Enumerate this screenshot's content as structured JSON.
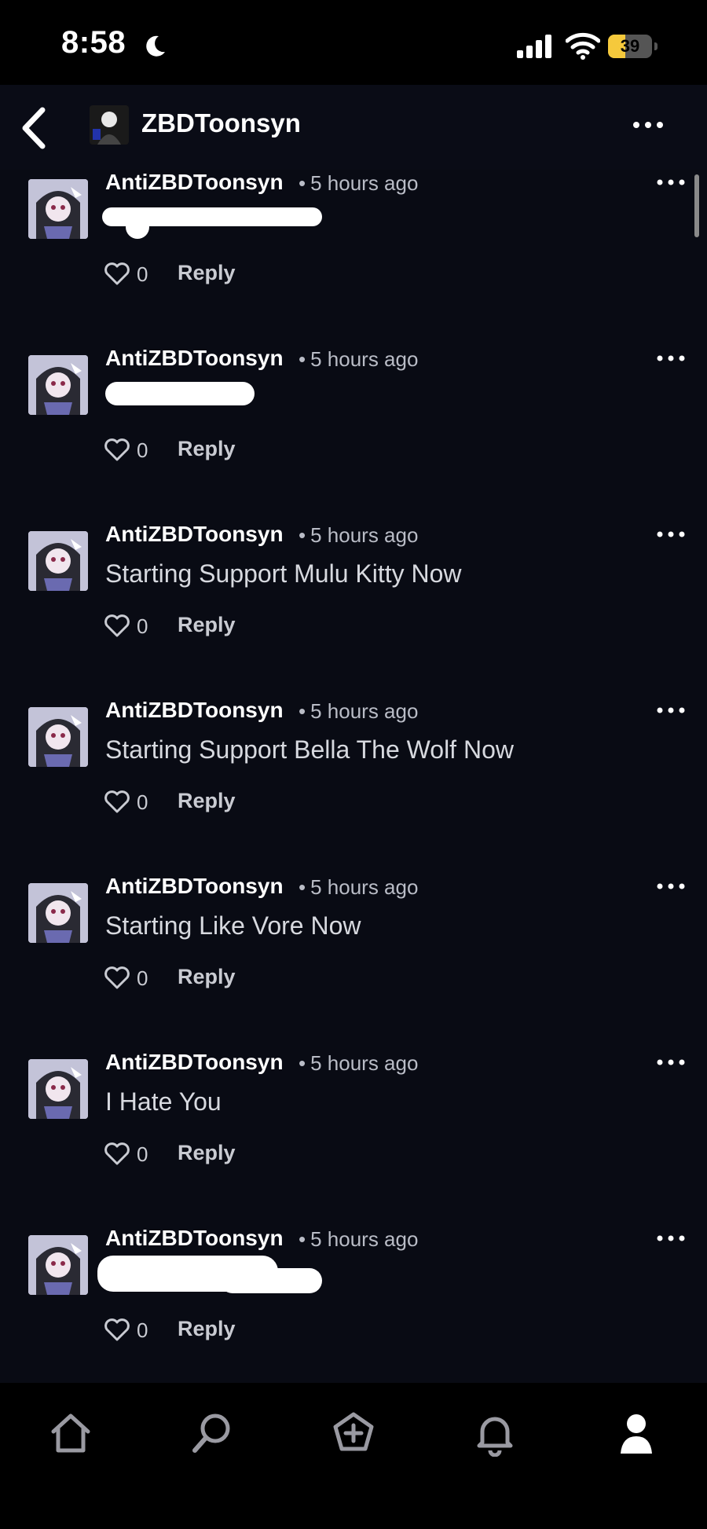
{
  "status_bar": {
    "time": "8:58",
    "battery": "39",
    "battery_level": 0.39,
    "battery_color": "#f5c93c"
  },
  "header": {
    "title": "ZBDToonsyn"
  },
  "comments": [
    {
      "author": "AntiZBDToonsyn",
      "time": "5 hours ago",
      "text": "",
      "likes": "0",
      "reply": "Reply",
      "redacted": true
    },
    {
      "author": "AntiZBDToonsyn",
      "time": "5 hours ago",
      "text": "",
      "likes": "0",
      "reply": "Reply",
      "redacted": true
    },
    {
      "author": "AntiZBDToonsyn",
      "time": "5 hours ago",
      "text": "Starting Support Mulu Kitty Now",
      "likes": "0",
      "reply": "Reply",
      "redacted": false
    },
    {
      "author": "AntiZBDToonsyn",
      "time": "5 hours ago",
      "text": "Starting Support Bella The Wolf Now",
      "likes": "0",
      "reply": "Reply",
      "redacted": false
    },
    {
      "author": "AntiZBDToonsyn",
      "time": "5 hours ago",
      "text": "Starting Like Vore Now",
      "likes": "0",
      "reply": "Reply",
      "redacted": false
    },
    {
      "author": "AntiZBDToonsyn",
      "time": "5 hours ago",
      "text": "I Hate You",
      "likes": "0",
      "reply": "Reply",
      "redacted": false
    },
    {
      "author": "AntiZBDToonsyn",
      "time": "5 hours ago",
      "text": "",
      "likes": "0",
      "reply": "Reply",
      "redacted": true
    }
  ],
  "icons": {
    "back": "chevron-left-icon",
    "more": "ellipsis-icon",
    "like": "heart-icon",
    "nav": [
      "home-icon",
      "search-icon",
      "create-icon",
      "bell-icon",
      "profile-icon"
    ]
  },
  "colors": {
    "background": "#090b14",
    "text_primary": "#ffffff",
    "text_secondary": "#b9bcc6"
  }
}
